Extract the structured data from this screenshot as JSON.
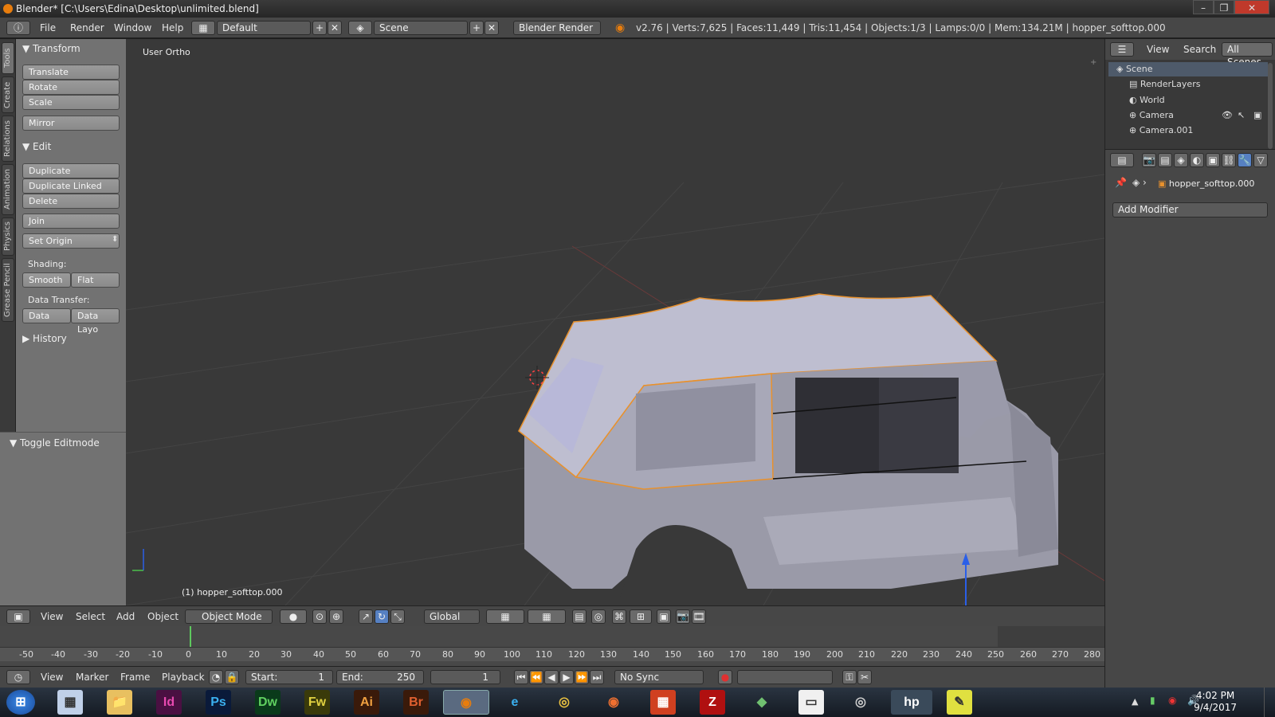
{
  "window": {
    "title": "Blender* [C:\\Users\\Edina\\Desktop\\unlimited.blend]"
  },
  "topbar": {
    "menus": [
      "File",
      "Render",
      "Window",
      "Help"
    ],
    "layout": "Default",
    "scene": "Scene",
    "engine": "Blender Render",
    "stats": "v2.76 | Verts:7,625 | Faces:11,449 | Tris:11,454 | Objects:1/3 | Lamps:0/0 | Mem:134.21M | hopper_softtop.000"
  },
  "tool_tabs": [
    "Tools",
    "Create",
    "Relations",
    "Animation",
    "Physics",
    "Grease Pencil"
  ],
  "toolshelf": {
    "transform_header": "Transform",
    "translate": "Translate",
    "rotate": "Rotate",
    "scale": "Scale",
    "mirror": "Mirror",
    "edit_header": "Edit",
    "duplicate": "Duplicate",
    "duplicate_linked": "Duplicate Linked",
    "delete": "Delete",
    "join": "Join",
    "set_origin": "Set Origin",
    "shading_label": "Shading:",
    "smooth": "Smooth",
    "flat": "Flat",
    "data_transfer_label": "Data Transfer:",
    "data": "Data",
    "data_layout": "Data Layo",
    "history_header": "History"
  },
  "operator": {
    "title": "Toggle Editmode"
  },
  "viewport": {
    "view_label": "User Ortho",
    "object_label": "(1) hopper_softtop.000"
  },
  "view_header": {
    "menus": [
      "View",
      "Select",
      "Add",
      "Object"
    ],
    "mode": "Object Mode",
    "orientation": "Global"
  },
  "timeline": {
    "ticks": [
      "-50",
      "-40",
      "-30",
      "-20",
      "-10",
      "0",
      "10",
      "20",
      "30",
      "40",
      "50",
      "60",
      "70",
      "80",
      "90",
      "100",
      "110",
      "120",
      "130",
      "140",
      "150",
      "160",
      "170",
      "180",
      "190",
      "200",
      "210",
      "220",
      "230",
      "240",
      "250",
      "260",
      "270",
      "280"
    ],
    "menus": [
      "View",
      "Marker",
      "Frame",
      "Playback"
    ],
    "start_label": "Start:",
    "start": "1",
    "end_label": "End:",
    "end": "250",
    "current": "1",
    "sync": "No Sync"
  },
  "outliner": {
    "menus": [
      "View",
      "Search"
    ],
    "scene_filter": "All Scenes",
    "items": [
      "Scene",
      "RenderLayers",
      "World",
      "Camera",
      "Camera.001"
    ]
  },
  "properties": {
    "object_name": "hopper_softtop.000",
    "add_modifier": "Add Modifier"
  },
  "taskbar": {
    "time": "4:02 PM",
    "date": "9/4/2017",
    "apps": [
      "Id",
      "Ps",
      "Dw",
      "Fw",
      "Ai",
      "Br"
    ]
  },
  "colors": {
    "selection_outline": "#e8912d",
    "viewport_bg": "#393939",
    "panel_bg": "#727272"
  }
}
